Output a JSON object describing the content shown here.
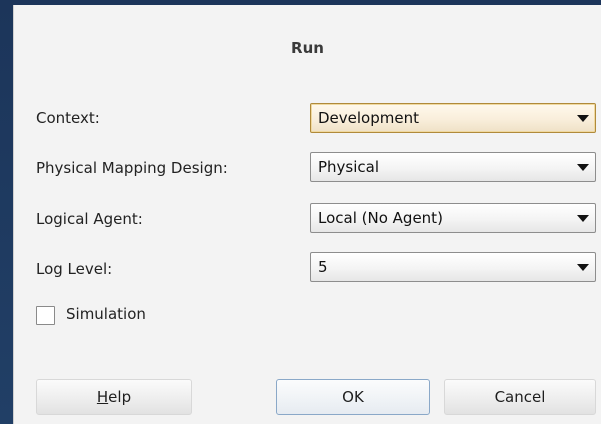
{
  "dialog": {
    "title": "Run",
    "fields": [
      {
        "label": "Context:",
        "value": "Development"
      },
      {
        "label": "Physical Mapping Design:",
        "value": "Physical"
      },
      {
        "label": "Logical Agent:",
        "value": "Local (No Agent)"
      },
      {
        "label": "Log Level:",
        "value": "5"
      }
    ],
    "simulation": {
      "label": "Simulation",
      "checked": false
    },
    "buttons": {
      "help_mnemonic": "H",
      "help_rest": "elp",
      "ok": "OK",
      "cancel": "Cancel"
    }
  },
  "colors": {
    "backdrop": "#1f3a5f",
    "dialog_bg": "#f3f3f3",
    "focus_border": "#b08a3a",
    "default_button_border": "#8aa8c8"
  }
}
